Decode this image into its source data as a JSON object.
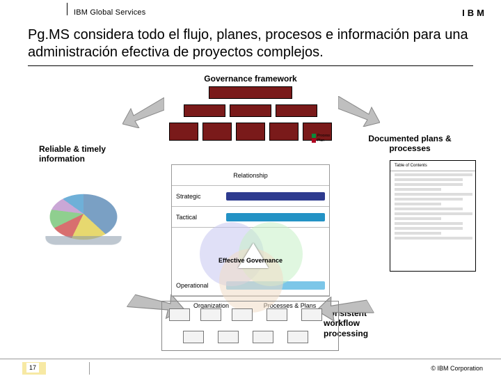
{
  "header": {
    "org": "IBM Global Services",
    "logo": "IBM"
  },
  "title": "Pg.MS considera todo el flujo, planes, procesos e información para una administración efectiva de proyectos complejos.",
  "labels": {
    "governance": "Governance framework",
    "reliable": "Reliable & timely information",
    "documented": "Documented plans & processes",
    "workflow": "Consistent workflow processing"
  },
  "effective": {
    "relationship": "Relationship",
    "strategic": "Strategic",
    "tactical": "Tactical",
    "operational": "Operational",
    "center": "Effective Governance",
    "org": "Organization",
    "pp": "Processes & Plans"
  },
  "gov_legend": {
    "process": "Process",
    "plan": "Plan"
  },
  "doc": {
    "title": "Table of Contents"
  },
  "footer": {
    "page": "17",
    "copyright": "© IBM Corporation"
  }
}
